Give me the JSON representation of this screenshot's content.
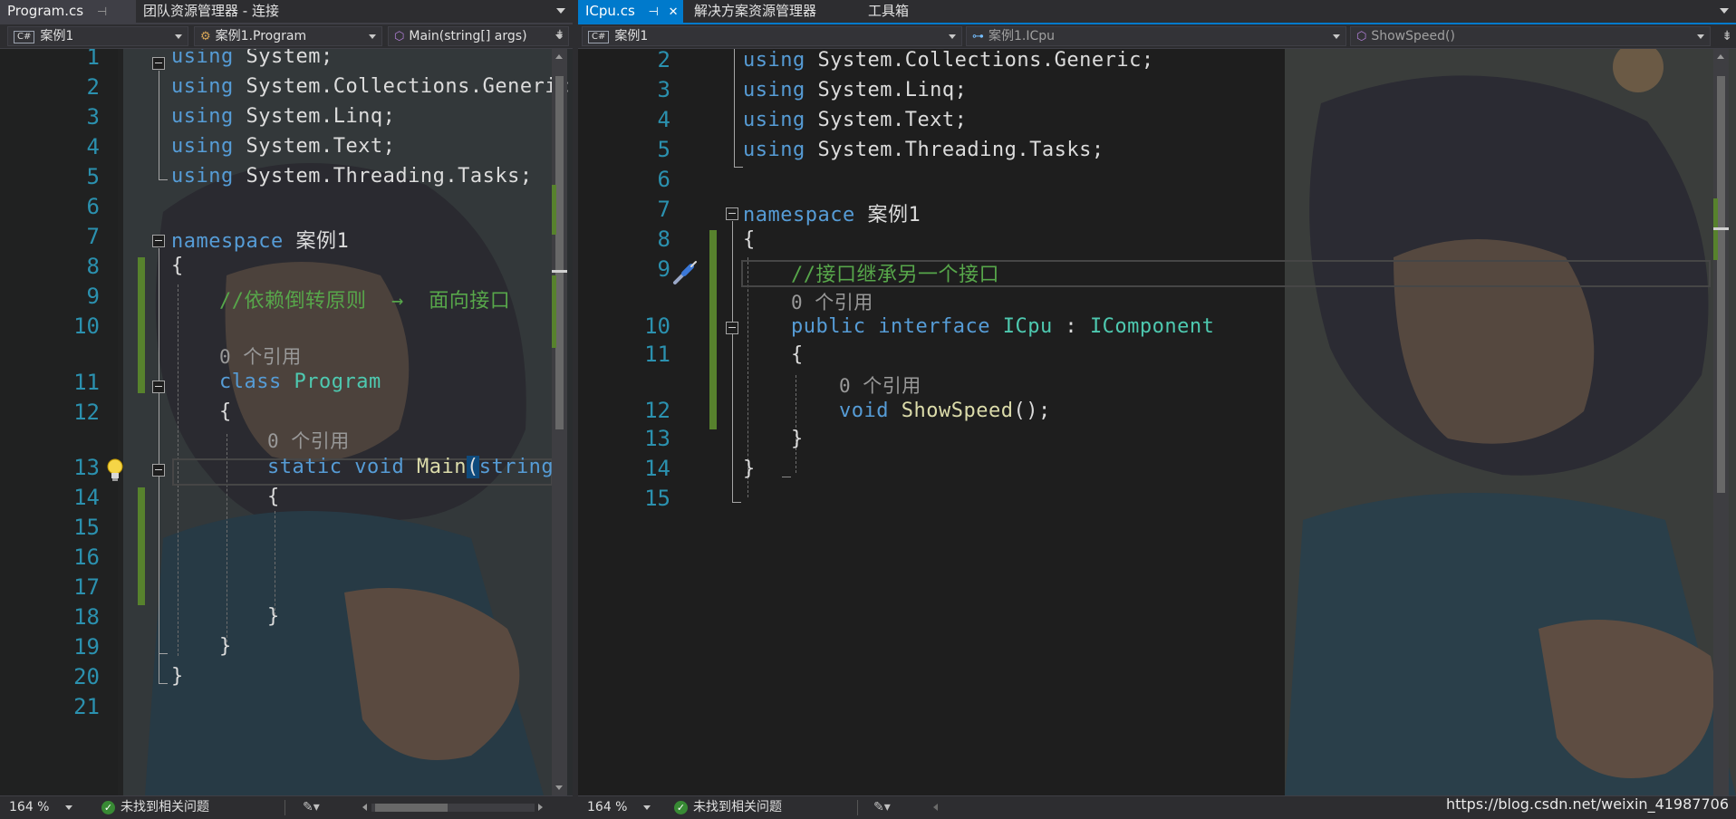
{
  "left": {
    "tabs": [
      {
        "label": "Program.cs",
        "pin": "⊣",
        "active": true
      },
      {
        "label": "团队资源管理器 - 连接"
      }
    ],
    "nav": {
      "project": "案例1",
      "class": "案例1.Program",
      "member": "Main(string[] args)"
    },
    "lines": [
      {
        "n": "1"
      },
      {
        "n": "2"
      },
      {
        "n": "3"
      },
      {
        "n": "4"
      },
      {
        "n": "5"
      },
      {
        "n": "6"
      },
      {
        "n": "7"
      },
      {
        "n": "8"
      },
      {
        "n": "9"
      },
      {
        "n": "10"
      },
      {
        "n": "11"
      },
      {
        "n": "12"
      },
      {
        "n": "13"
      },
      {
        "n": "14"
      },
      {
        "n": "15"
      },
      {
        "n": "16"
      },
      {
        "n": "17"
      },
      {
        "n": "18"
      },
      {
        "n": "19"
      },
      {
        "n": "20"
      },
      {
        "n": "21"
      }
    ],
    "code": {
      "using": "using",
      "system": " System;",
      "collections": " System.Collections.Generic",
      "linq": " System.Linq;",
      "text": " System.Text;",
      "tasks": " System.Threading.Tasks;",
      "namespace_kw": "namespace",
      "namespace_name": " 案例1",
      "brace_open": "{",
      "brace_close": "}",
      "comment": "//依赖倒转原则  →  面向接口",
      "refs": "0 个引用",
      "class_kw": "class",
      "class_name": "Program",
      "static_kw": "static",
      "void_kw": "void",
      "main_name": "Main",
      "paren": "(",
      "string_kw": "string"
    },
    "status": {
      "zoom": "164 %",
      "issues": "未找到相关问题"
    }
  },
  "right": {
    "tabs": [
      {
        "label": "ICpu.cs",
        "pin": "⊣",
        "close": "✕",
        "active": true
      },
      {
        "label": "解决方案资源管理器"
      },
      {
        "label": "工具箱"
      }
    ],
    "nav": {
      "project": "案例1",
      "iface": "案例1.ICpu",
      "member": "ShowSpeed()"
    },
    "lines": [
      {
        "n": "2"
      },
      {
        "n": "3"
      },
      {
        "n": "4"
      },
      {
        "n": "5"
      },
      {
        "n": "6"
      },
      {
        "n": "7"
      },
      {
        "n": "8"
      },
      {
        "n": "9"
      },
      {
        "n": "10"
      },
      {
        "n": "11"
      },
      {
        "n": "12"
      },
      {
        "n": "13"
      },
      {
        "n": "14"
      },
      {
        "n": "15"
      }
    ],
    "code": {
      "using": "using",
      "collections": " System.Collections.Generic;",
      "linq": " System.Linq;",
      "text": " System.Text;",
      "tasks": " System.Threading.Tasks;",
      "namespace_kw": "namespace",
      "namespace_name": " 案例1",
      "brace_open": "{",
      "brace_close": "}",
      "comment": "//接口继承另一个接口",
      "refs": "0 个引用",
      "public_kw": "public",
      "interface_kw": "interface",
      "iface_name": "ICpu",
      "colon": " : ",
      "base_name": "IComponent",
      "void_kw": "void",
      "method_name": "ShowSpeed",
      "call_tail": "();"
    },
    "status": {
      "zoom": "164 %",
      "issues": "未找到相关问题"
    }
  },
  "watermark": "https://blog.csdn.net/weixin_41987706",
  "colors": {
    "accent": "#007acc",
    "keyword": "#569cd6",
    "type": "#4ec9b0",
    "method": "#dcdcaa",
    "comment": "#57a64a",
    "line_number": "#2b91af",
    "changed_bar": "#57822d"
  },
  "icons": [
    "pin-icon",
    "close-icon",
    "csharp-project-icon",
    "class-icon",
    "method-icon",
    "interface-icon",
    "lightbulb-icon",
    "screwdriver-icon",
    "check-icon",
    "brush-icon",
    "split-icon"
  ]
}
